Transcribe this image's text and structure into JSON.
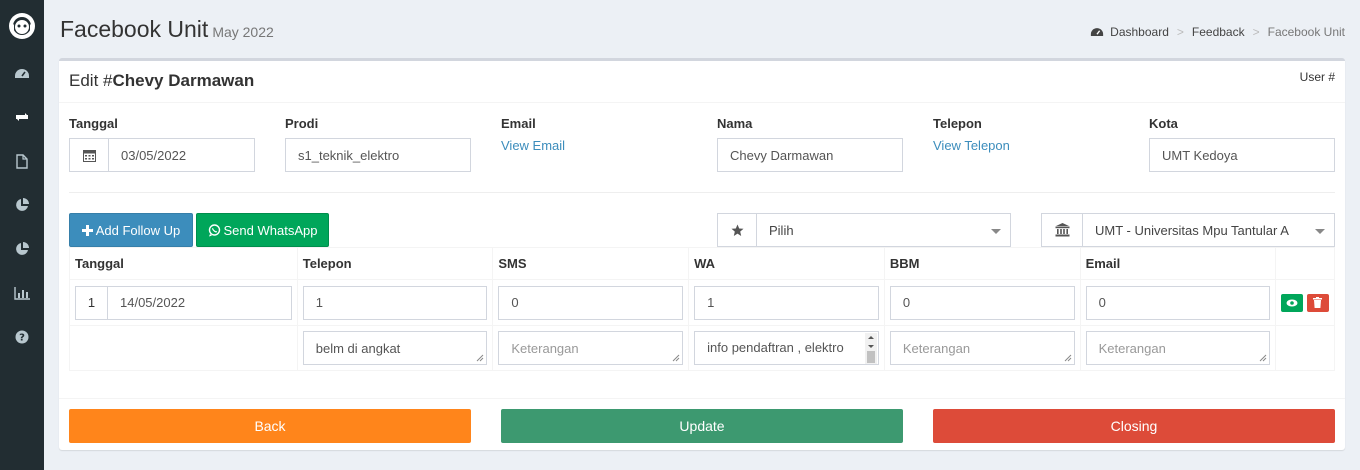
{
  "header": {
    "title": "Facebook Unit",
    "subtitle": "May 2022",
    "breadcrumb": [
      "Dashboard",
      "Feedback",
      "Facebook Unit"
    ]
  },
  "box": {
    "title_prefix": "Edit #",
    "title_name": "Chevy Darmawan",
    "tools": "User #"
  },
  "fields": {
    "tanggal_label": "Tanggal",
    "tanggal_value": "03/05/2022",
    "prodi_label": "Prodi",
    "prodi_value": "s1_teknik_elektro",
    "email_label": "Email",
    "email_link": "View Email",
    "nama_label": "Nama",
    "nama_value": "Chevy Darmawan",
    "telepon_label": "Telepon",
    "telepon_link": "View Telepon",
    "kota_label": "Kota",
    "kota_value": "UMT Kedoya"
  },
  "actions": {
    "add_follow_up": "Add Follow Up",
    "send_whatsapp": "Send WhatsApp",
    "status_select": "Pilih",
    "campus_select": "UMT - Universitas Mpu Tantular A"
  },
  "table": {
    "headers": [
      "Tanggal",
      "Telepon",
      "SMS",
      "WA",
      "BBM",
      "Email"
    ],
    "row": {
      "index": "1",
      "tanggal": "14/05/2022",
      "telepon": "1",
      "sms": "0",
      "wa": "1",
      "bbm": "0",
      "email": "0"
    },
    "notes": {
      "telepon": "belm di angkat",
      "sms": "",
      "wa": "info pendaftran , elektro",
      "bbm": "",
      "email": "",
      "placeholder": "Keterangan"
    }
  },
  "footer": {
    "back": "Back",
    "update": "Update",
    "closing": "Closing"
  },
  "colors": {
    "sidebar": "#222d32",
    "primary": "#3c8dbc",
    "success": "#00a65a",
    "back": "#ff851b",
    "update": "#3d9970",
    "closing": "#dd4b39"
  }
}
